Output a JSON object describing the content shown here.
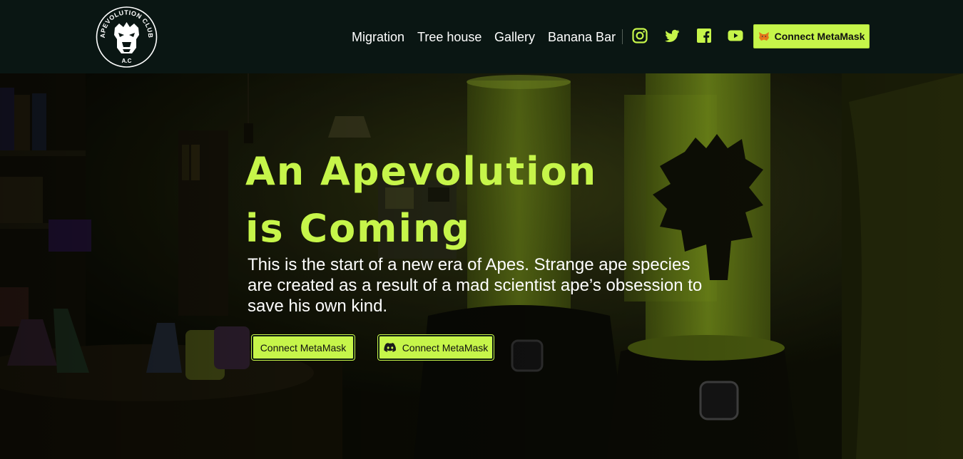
{
  "brand": {
    "logo_top_text": "APEVOLUTION CLUB",
    "logo_bottom_text": "A.C"
  },
  "nav": {
    "links": [
      "Migration",
      "Tree house",
      "Gallery",
      "Banana Bar"
    ],
    "social_icons": [
      "instagram-icon",
      "twitter-icon",
      "facebook-icon",
      "youtube-icon"
    ],
    "connect_button": "Connect MetaMask"
  },
  "hero": {
    "title_line1": "An Apevolution",
    "title_line2": "is Coming",
    "description": "This is the start of a new era of Apes. Strange ape species are created as a result of a mad scientist ape’s obsession to save his own kind.",
    "button_metamask": "Connect MetaMask",
    "button_discord": "Connect MetaMask"
  },
  "colors": {
    "accent": "#c6f54a",
    "nav_bg": "#0a1613",
    "text": "#ffffff"
  }
}
